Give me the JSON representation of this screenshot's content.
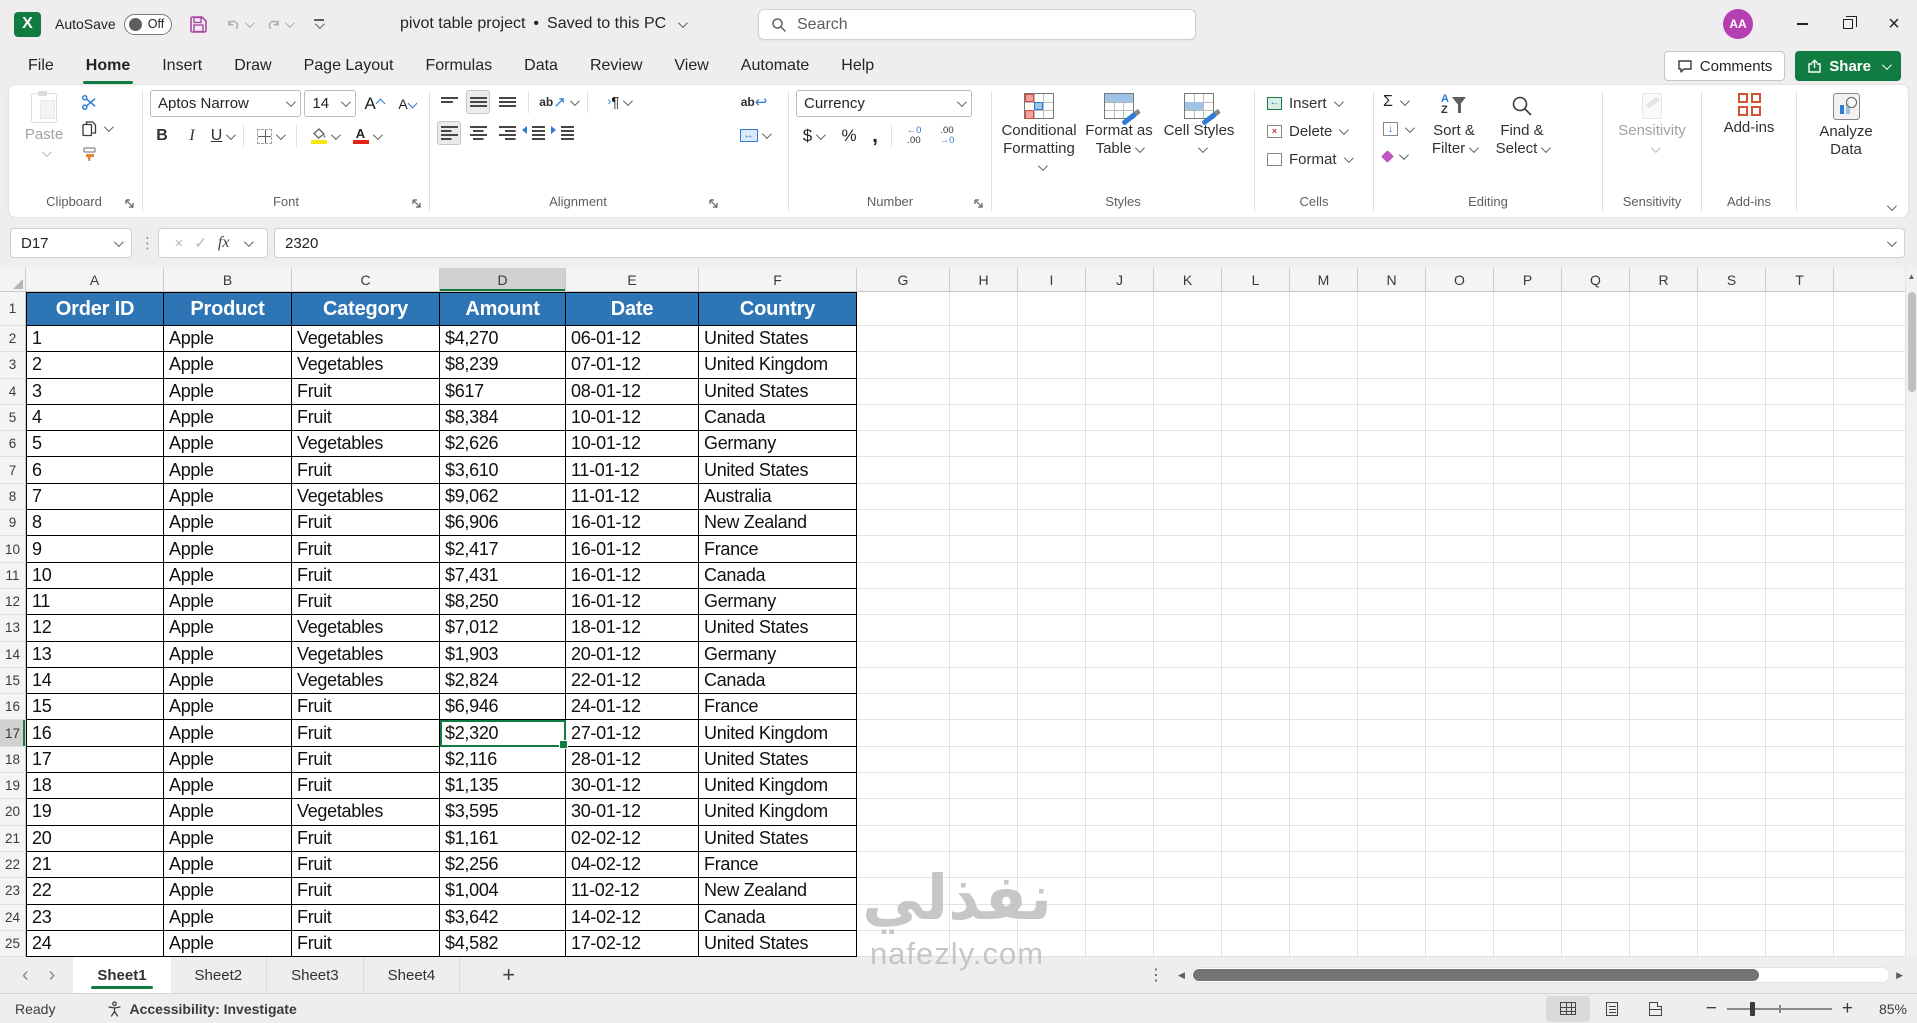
{
  "titlebar": {
    "autosave_label": "AutoSave",
    "autosave_state": "Off",
    "title": "pivot table project",
    "separator": "•",
    "saved_status": "Saved to this PC",
    "search_placeholder": "Search",
    "avatar_initials": "AA"
  },
  "ribbon_tabs": {
    "items": [
      "File",
      "Home",
      "Insert",
      "Draw",
      "Page Layout",
      "Formulas",
      "Data",
      "Review",
      "View",
      "Automate",
      "Help"
    ],
    "active_index": 1
  },
  "top_buttons": {
    "comments": "Comments",
    "share": "Share"
  },
  "ribbon": {
    "clipboard": {
      "label": "Clipboard",
      "paste": "Paste"
    },
    "font": {
      "label": "Font",
      "font_name": "Aptos Narrow",
      "font_size": "14"
    },
    "alignment": {
      "label": "Alignment"
    },
    "number": {
      "label": "Number",
      "format": "Currency"
    },
    "styles": {
      "label": "Styles",
      "conditional_formatting": "Conditional Formatting",
      "format_as_table": "Format as Table",
      "cell_styles": "Cell Styles"
    },
    "cells": {
      "label": "Cells",
      "insert": "Insert",
      "delete": "Delete",
      "format": "Format"
    },
    "editing": {
      "label": "Editing",
      "sort_filter": "Sort & Filter",
      "find_select": "Find & Select"
    },
    "sensitivity": {
      "label": "Sensitivity",
      "button": "Sensitivity"
    },
    "addins": {
      "label": "Add-ins",
      "button": "Add-ins"
    },
    "analyze": {
      "button": "Analyze Data"
    }
  },
  "glyphs": {
    "bold": "B",
    "italic": "I",
    "underline": "U",
    "font_letter": "A",
    "wrap_ab": "ab",
    "wrap_arrow": "↩",
    "orient_ab": "ab",
    "orient_arrow": "↗",
    "pilcrow": "¶",
    "gt": "›",
    "merge_arrows": "↔",
    "dollar": "$",
    "percent": "%",
    "comma": ",",
    "dec_inc_top": "←0",
    "dec_inc_bottom": ".00",
    "dec_dec_top": ".00",
    "dec_dec_bottom": "→0",
    "sum": "Σ",
    "fill_arrow": "↓",
    "sort_a": "A",
    "sort_z": "Z",
    "fx": "fx",
    "cancel": "×",
    "enter": "✓",
    "nav_left": "‹",
    "nav_right": "›",
    "add_sheet": "+",
    "dots": "⋮",
    "scroll_left": "◀",
    "scroll_right": "▶",
    "scroll_up": "▲",
    "minus": "−",
    "plus": "+",
    "delete_x": "×"
  },
  "formula_bar": {
    "name_box": "D17",
    "formula": "2320"
  },
  "grid": {
    "column_letters": [
      "A",
      "B",
      "C",
      "D",
      "E",
      "F",
      "G",
      "H",
      "I",
      "J",
      "K",
      "L",
      "M",
      "N",
      "O",
      "P",
      "Q",
      "R",
      "S",
      "T"
    ],
    "row_count": 25,
    "selected_column": "D",
    "selected_row": 17,
    "selection_cell": "D17",
    "table": {
      "headers": [
        "Order ID",
        "Product",
        "Category",
        "Amount",
        "Date",
        "Country"
      ],
      "rows": [
        [
          "1",
          "Apple",
          "Vegetables",
          "$4,270",
          "06-01-12",
          "United States"
        ],
        [
          "2",
          "Apple",
          "Vegetables",
          "$8,239",
          "07-01-12",
          "United Kingdom"
        ],
        [
          "3",
          "Apple",
          "Fruit",
          "$617",
          "08-01-12",
          "United States"
        ],
        [
          "4",
          "Apple",
          "Fruit",
          "$8,384",
          "10-01-12",
          "Canada"
        ],
        [
          "5",
          "Apple",
          "Vegetables",
          "$2,626",
          "10-01-12",
          "Germany"
        ],
        [
          "6",
          "Apple",
          "Fruit",
          "$3,610",
          "11-01-12",
          "United States"
        ],
        [
          "7",
          "Apple",
          "Vegetables",
          "$9,062",
          "11-01-12",
          "Australia"
        ],
        [
          "8",
          "Apple",
          "Fruit",
          "$6,906",
          "16-01-12",
          "New Zealand"
        ],
        [
          "9",
          "Apple",
          "Fruit",
          "$2,417",
          "16-01-12",
          "France"
        ],
        [
          "10",
          "Apple",
          "Fruit",
          "$7,431",
          "16-01-12",
          "Canada"
        ],
        [
          "11",
          "Apple",
          "Fruit",
          "$8,250",
          "16-01-12",
          "Germany"
        ],
        [
          "12",
          "Apple",
          "Vegetables",
          "$7,012",
          "18-01-12",
          "United States"
        ],
        [
          "13",
          "Apple",
          "Vegetables",
          "$1,903",
          "20-01-12",
          "Germany"
        ],
        [
          "14",
          "Apple",
          "Vegetables",
          "$2,824",
          "22-01-12",
          "Canada"
        ],
        [
          "15",
          "Apple",
          "Fruit",
          "$6,946",
          "24-01-12",
          "France"
        ],
        [
          "16",
          "Apple",
          "Fruit",
          "$2,320",
          "27-01-12",
          "United Kingdom"
        ],
        [
          "17",
          "Apple",
          "Fruit",
          "$2,116",
          "28-01-12",
          "United States"
        ],
        [
          "18",
          "Apple",
          "Fruit",
          "$1,135",
          "30-01-12",
          "United Kingdom"
        ],
        [
          "19",
          "Apple",
          "Vegetables",
          "$3,595",
          "30-01-12",
          "United Kingdom"
        ],
        [
          "20",
          "Apple",
          "Fruit",
          "$1,161",
          "02-02-12",
          "United States"
        ],
        [
          "21",
          "Apple",
          "Fruit",
          "$2,256",
          "04-02-12",
          "France"
        ],
        [
          "22",
          "Apple",
          "Fruit",
          "$1,004",
          "11-02-12",
          "New Zealand"
        ],
        [
          "23",
          "Apple",
          "Fruit",
          "$3,642",
          "14-02-12",
          "Canada"
        ],
        [
          "24",
          "Apple",
          "Fruit",
          "$4,582",
          "17-02-12",
          "United States"
        ]
      ]
    }
  },
  "sheet_bar": {
    "sheets": [
      "Sheet1",
      "Sheet2",
      "Sheet3",
      "Sheet4"
    ],
    "active_index": 0
  },
  "status_bar": {
    "ready": "Ready",
    "accessibility": "Accessibility: Investigate",
    "zoom": "85%"
  },
  "watermark": {
    "arabic": "نفذلي",
    "latin": "nafezly.com"
  },
  "colors": {
    "accent_green": "#107C41",
    "header_blue": "#2E75B6",
    "avatar_purple": "#B43FB0",
    "addins_orange": "#D35230",
    "fill_yellow": "#F7E614",
    "font_red": "#E2241A",
    "selection_gray": "#D2D0D0"
  }
}
